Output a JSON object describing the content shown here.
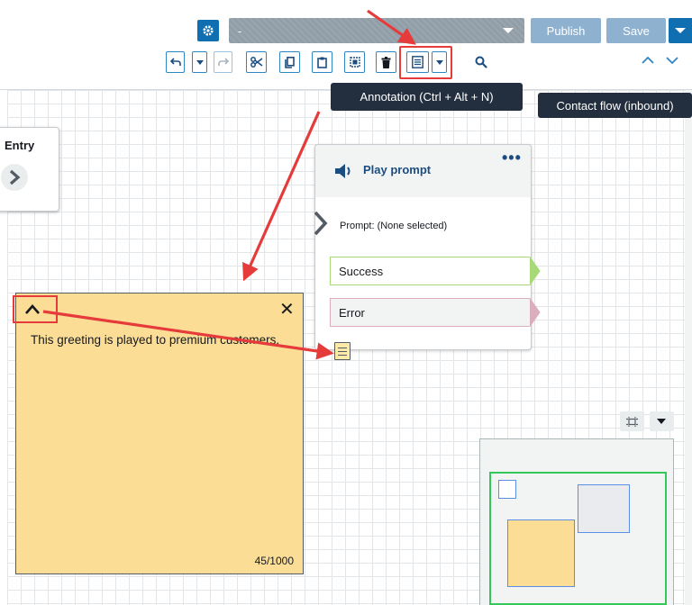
{
  "header": {
    "flow_name": "-",
    "publish_label": "Publish",
    "save_label": "Save"
  },
  "tooltips": {
    "annotation": "Annotation (Ctrl + Alt + N)",
    "contact_flow": "Contact flow (inbound)"
  },
  "entry_block": {
    "label": "Entry"
  },
  "play_prompt": {
    "title": "Play prompt",
    "more": "•••",
    "prompt_text": "Prompt: (None selected)",
    "branches": [
      "Success",
      "Error"
    ]
  },
  "annotation_note": {
    "text": "This greeting is played to premium customers.",
    "char_count": "45/1000"
  },
  "colors": {
    "primary": "#0f6fb1",
    "disabled_button": "#8fb1d0",
    "note_background": "#fbdd96",
    "callout_red": "#e53b3b",
    "success_green": "#a8d977",
    "error_pink": "#dbadbd"
  }
}
